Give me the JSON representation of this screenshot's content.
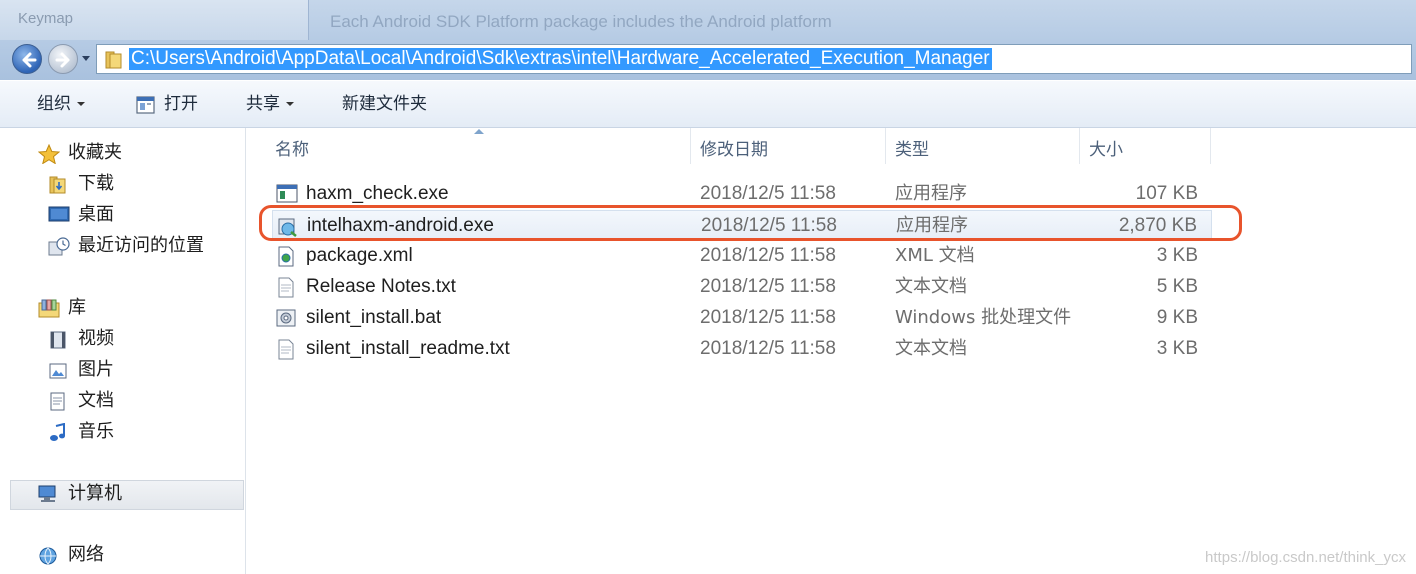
{
  "background_window": {
    "title": "Keymap",
    "text_lines": [
      "Each Android SDK Platform package includes the Android platform",
      "",
      ""
    ]
  },
  "address_bar": {
    "path": "C:\\Users\\Android\\AppData\\Local\\Android\\Sdk\\extras\\intel\\Hardware_Accelerated_Execution_Manager"
  },
  "toolbar": {
    "organize": "组织",
    "open": "打开",
    "share": "共享",
    "new_folder": "新建文件夹"
  },
  "nav": {
    "favorites": "收藏夹",
    "downloads": "下载",
    "desktop": "桌面",
    "recent": "最近访问的位置",
    "libraries": "库",
    "videos": "视频",
    "pictures": "图片",
    "documents": "文档",
    "music": "音乐",
    "computer": "计算机",
    "network": "网络"
  },
  "columns": {
    "name": "名称",
    "date": "修改日期",
    "type": "类型",
    "size": "大小"
  },
  "files": [
    {
      "name": "haxm_check.exe",
      "date": "2018/12/5 11:58",
      "type": "应用程序",
      "size": "107 KB",
      "icon": "exe-icon"
    },
    {
      "name": "intelhaxm-android.exe",
      "date": "2018/12/5 11:58",
      "type": "应用程序",
      "size": "2,870 KB",
      "icon": "installer-icon"
    },
    {
      "name": "package.xml",
      "date": "2018/12/5 11:58",
      "type": "XML 文档",
      "size": "3 KB",
      "icon": "xml-icon"
    },
    {
      "name": "Release Notes.txt",
      "date": "2018/12/5 11:58",
      "type": "文本文档",
      "size": "5 KB",
      "icon": "txt-icon"
    },
    {
      "name": "silent_install.bat",
      "date": "2018/12/5 11:58",
      "type": "Windows 批处理文件",
      "size": "9 KB",
      "icon": "bat-icon"
    },
    {
      "name": "silent_install_readme.txt",
      "date": "2018/12/5 11:58",
      "type": "文本文档",
      "size": "3 KB",
      "icon": "txt-icon"
    }
  ],
  "highlight_color": "#e8542c",
  "selection_color": "#3399ff",
  "watermark": "https://blog.csdn.net/think_ycx"
}
